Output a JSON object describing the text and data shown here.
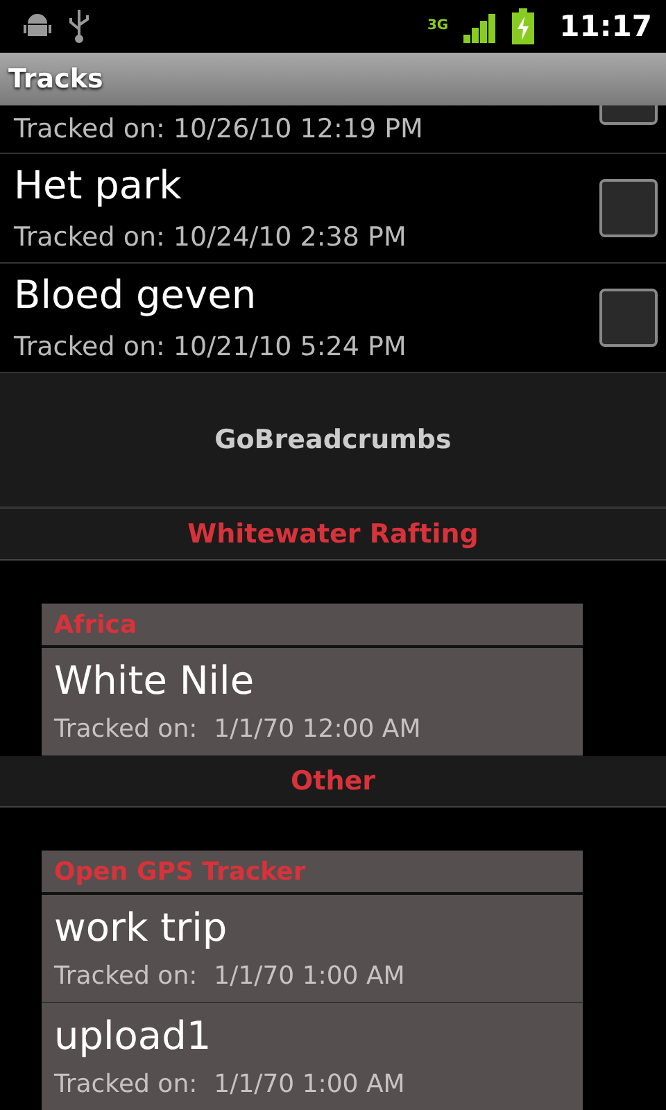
{
  "status_bar": {
    "time": "11:17",
    "network": "3G"
  },
  "title": "Tracks",
  "tracks": [
    {
      "date": "Tracked on: 10/26/10 12:19 PM",
      "checked": false,
      "cut": true
    },
    {
      "name": "Het park",
      "date": "Tracked on: 10/24/10 2:38 PM",
      "checked": false,
      "cut": false
    },
    {
      "name": "Bloed geven",
      "date": "Tracked on: 10/21/10 5:24 PM",
      "checked": false,
      "cut": false
    }
  ],
  "app_banner": "GoBreadcrumbs",
  "sections": [
    {
      "title": "Whitewater Rafting",
      "cards": [
        {
          "source": "Africa",
          "items": [
            {
              "name": "White Nile",
              "label": "Tracked on:",
              "date": "1/1/70 12:00 AM"
            }
          ]
        }
      ]
    },
    {
      "title": "Other",
      "cards": [
        {
          "source": "Open GPS Tracker",
          "items": [
            {
              "name": "work trip",
              "label": "Tracked on:",
              "date": "1/1/70 1:00 AM"
            },
            {
              "name": "upload1",
              "label": "Tracked on:",
              "date": "1/1/70 1:00 AM"
            }
          ]
        }
      ]
    }
  ]
}
